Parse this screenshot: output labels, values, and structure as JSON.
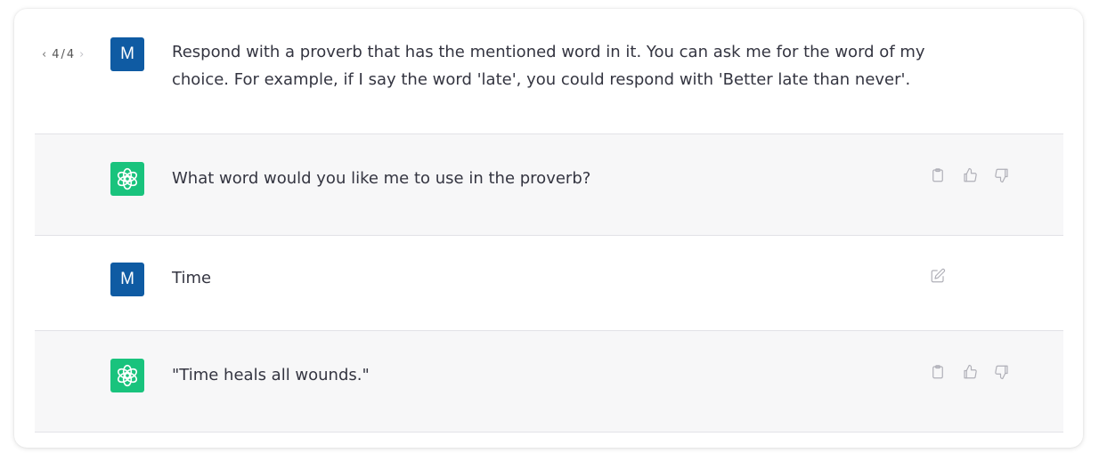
{
  "conversation": {
    "messages": [
      {
        "role": "user",
        "avatar_letter": "M",
        "pager": {
          "current": "4",
          "total": "4",
          "separator": "/"
        },
        "lines": [
          "Respond with a proverb that has the mentioned word in it. You can ask me for the word of my",
          "choice. For example, if I say the word 'late', you could respond with 'Better late than never'."
        ]
      },
      {
        "role": "assistant",
        "text": "What word would you like me to use in the proverb?",
        "actions": [
          "clipboard-icon",
          "thumbs-up-icon",
          "thumbs-down-icon"
        ]
      },
      {
        "role": "user",
        "avatar_letter": "M",
        "text": "Time",
        "actions": [
          "edit-icon"
        ]
      },
      {
        "role": "assistant",
        "text": "\"Time heals all wounds.\"",
        "actions": [
          "clipboard-icon",
          "thumbs-up-icon",
          "thumbs-down-icon"
        ]
      }
    ]
  },
  "colors": {
    "user_avatar_bg": "#0f5ba3",
    "assistant_avatar_bg": "#19c37d",
    "assistant_row_bg": "#f7f7f8",
    "text": "#343541",
    "icon": "#b0b0b8"
  }
}
